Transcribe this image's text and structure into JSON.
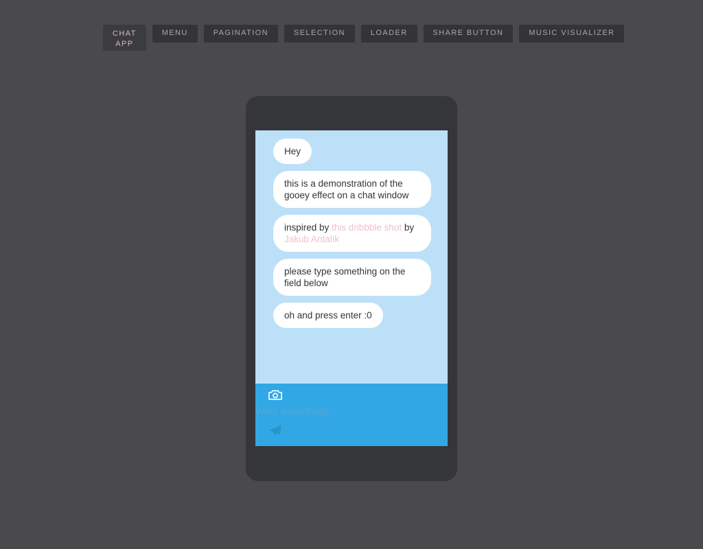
{
  "tabs": [
    {
      "label": "CHAT\nAPP",
      "name": "tab-chat-app",
      "active": true
    },
    {
      "label": "MENU",
      "name": "tab-menu",
      "active": false
    },
    {
      "label": "PAGINATION",
      "name": "tab-pagination",
      "active": false
    },
    {
      "label": "SELECTION",
      "name": "tab-selection",
      "active": false
    },
    {
      "label": "LOADER",
      "name": "tab-loader",
      "active": false
    },
    {
      "label": "SHARE BUTTON",
      "name": "tab-share-button",
      "active": false
    },
    {
      "label": "MUSIC VISUALIZER",
      "name": "tab-music-visualizer",
      "active": false
    }
  ],
  "chat": {
    "messages": [
      {
        "text": "Hey",
        "wide": false
      },
      {
        "text": "this is a demonstration of the gooey effect on a chat window",
        "wide": true
      },
      {
        "wide": true,
        "parts": [
          {
            "type": "text",
            "text": "inspired by "
          },
          {
            "type": "link",
            "text": "this dribbble shot"
          },
          {
            "type": "text",
            "text": " by "
          },
          {
            "type": "link",
            "text": "Jakub Antalík"
          }
        ]
      },
      {
        "text": "please type something on the field below",
        "wide": true
      },
      {
        "text": "oh and press enter :0",
        "wide": false
      }
    ]
  },
  "input": {
    "value": "",
    "placeholder": "Write something...",
    "camera_icon": "camera-icon",
    "send_icon": "send-paper-plane-icon"
  },
  "colors": {
    "page_background": "#4a4a4d",
    "phone_body": "#353639",
    "screen_background": "#bce0f7",
    "bubble_background": "#ffffff",
    "bubble_text": "#343434",
    "link": "#f0c0cc",
    "input_bar": "#31a8e5",
    "placeholder": "#5ea2cd",
    "tab_background": "#333438",
    "tab_text": "#a9a9ad",
    "tab_active_text": "#d9b6c0"
  }
}
